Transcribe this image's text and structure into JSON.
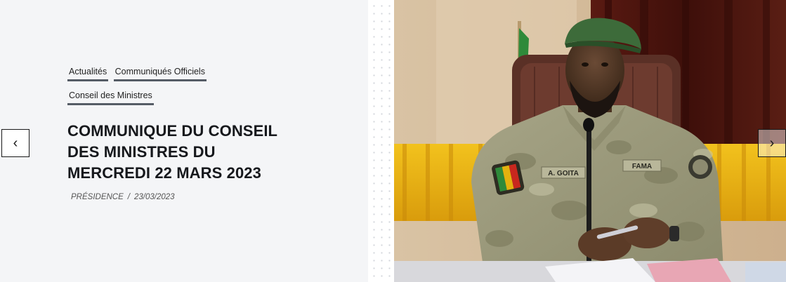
{
  "slide": {
    "categories": [
      "Actualités",
      "Communiqués Officiels",
      "Conseil des Ministres"
    ],
    "title": "COMMUNIQUE DU CONSEIL DES MINISTRES DU MERCREDI 22 MARS 2023",
    "author": "PRÉSIDENCE",
    "separator": "/",
    "date": "23/03/2023",
    "photo_name_tag": "A. GOITA",
    "photo_unit_tag": "FAMA"
  },
  "nav": {
    "prev_icon": "‹",
    "next_icon": "›"
  },
  "colors": {
    "background": "#f4f5f7",
    "tag_underline": "#555c66",
    "title": "#16181c",
    "camo": "#9a9b7c",
    "beret": "#3d6b3a"
  }
}
